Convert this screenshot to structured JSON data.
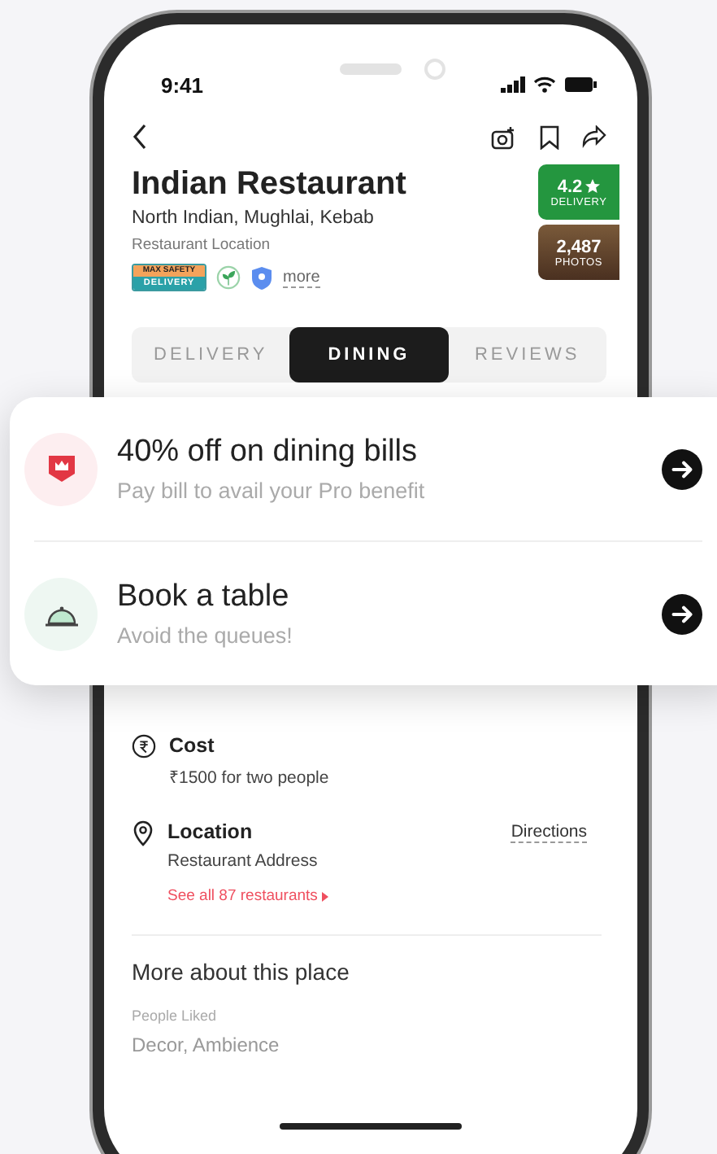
{
  "status_bar": {
    "time": "9:41"
  },
  "restaurant": {
    "name": "Indian Restaurant",
    "cuisines": "North Indian, Mughlai, Kebab",
    "location": "Restaurant Location",
    "safety_badge": {
      "top": "MAX SAFETY",
      "bottom": "DELIVERY"
    },
    "more": "more",
    "rating": {
      "value": "4.2",
      "label": "DELIVERY"
    },
    "photos": {
      "count": "2,487",
      "label": "PHOTOS"
    }
  },
  "tabs": [
    {
      "label": "DELIVERY",
      "selected": false
    },
    {
      "label": "DINING",
      "selected": true
    },
    {
      "label": "REVIEWS",
      "selected": false
    }
  ],
  "offers": [
    {
      "kind": "pro",
      "title": "40% off on dining bills",
      "subtitle": "Pay bill to avail your Pro benefit"
    },
    {
      "kind": "table",
      "title": "Book a table",
      "subtitle": "Avoid the queues!"
    }
  ],
  "info": [
    {
      "kind": "cost",
      "title": "Cost",
      "text": "₹1500 for two people"
    },
    {
      "kind": "location",
      "title": "Location",
      "text": "Restaurant Address",
      "action": "Directions",
      "link": "See all 87 restaurants"
    }
  ],
  "more_about": {
    "heading": "More about this place",
    "label": "People Liked",
    "value": "Decor, Ambience"
  }
}
